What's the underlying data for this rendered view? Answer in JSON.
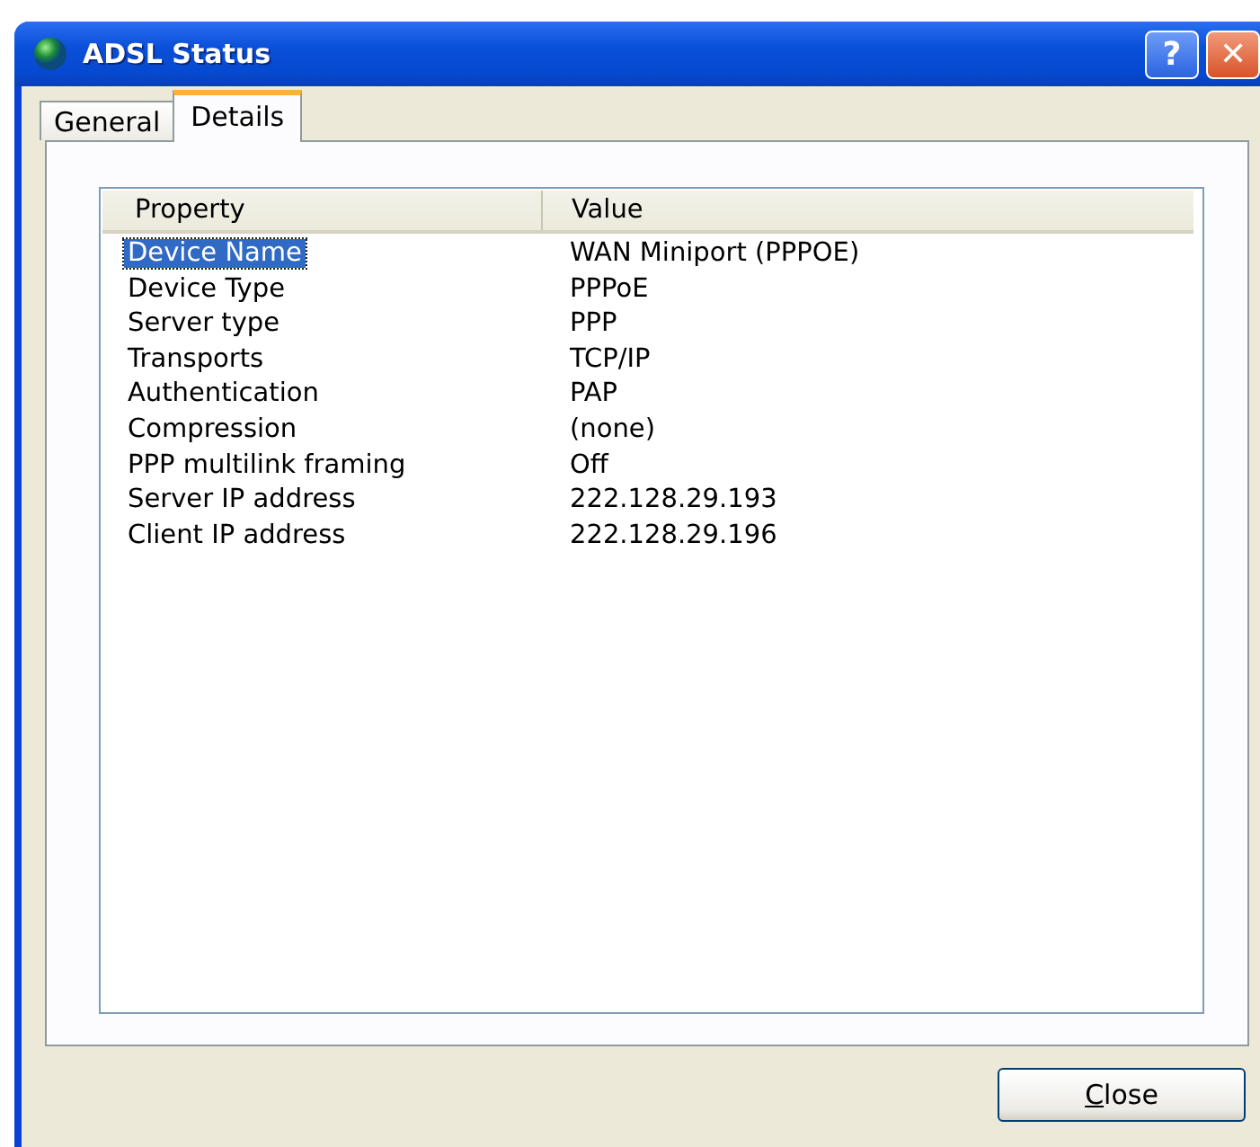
{
  "window": {
    "title": "ADSL Status"
  },
  "title_buttons": [
    {
      "kind": "help",
      "label": "?"
    },
    {
      "kind": "close",
      "label": "✕"
    }
  ],
  "tabs": [
    {
      "label": "General",
      "selected": false
    },
    {
      "label": "Details",
      "selected": true
    }
  ],
  "table": {
    "columns": [
      "Property",
      "Value"
    ],
    "rows": [
      {
        "property": "Device Name",
        "value": "WAN Miniport (PPPOE)",
        "selected": true
      },
      {
        "property": "Device Type",
        "value": "PPPoE",
        "selected": false
      },
      {
        "property": "Server type",
        "value": "PPP",
        "selected": false
      },
      {
        "property": "Transports",
        "value": "TCP/IP",
        "selected": false
      },
      {
        "property": "Authentication",
        "value": "PAP",
        "selected": false
      },
      {
        "property": "Compression",
        "value": "(none)",
        "selected": false
      },
      {
        "property": "PPP multilink framing",
        "value": "Off",
        "selected": false
      },
      {
        "property": "Server IP address",
        "value": "222.128.29.193",
        "selected": false
      },
      {
        "property": "Client IP address",
        "value": "222.128.29.196",
        "selected": false
      }
    ]
  },
  "buttons": [
    {
      "label": "Close",
      "underlined_first": true
    }
  ]
}
